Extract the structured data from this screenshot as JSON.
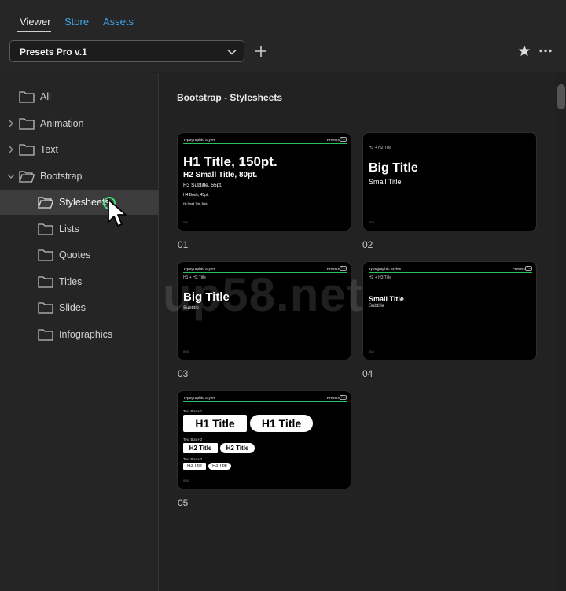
{
  "tabs": [
    {
      "label": "Viewer"
    },
    {
      "label": "Store"
    },
    {
      "label": "Assets"
    }
  ],
  "preset": {
    "selected": "Presets Pro v.1"
  },
  "icons": {
    "chevron": "chevron-down-icon",
    "add": "plus-icon",
    "favorite": "star-icon",
    "more": "more-horizontal-icon",
    "folder": "folder-icon"
  },
  "sidebar": {
    "items": [
      {
        "label": "All"
      },
      {
        "label": "Animation"
      },
      {
        "label": "Text"
      },
      {
        "label": "Bootstrap"
      },
      {
        "label": "Stylesheets"
      },
      {
        "label": "Lists"
      },
      {
        "label": "Quotes"
      },
      {
        "label": "Titles"
      },
      {
        "label": "Slides"
      },
      {
        "label": "Infographics"
      }
    ]
  },
  "section": {
    "title": "Bootstrap - Stylesheets"
  },
  "cards": [
    {
      "label": "01",
      "header_left": "Typographic Styles",
      "header_right": "Presets",
      "header_badge": "Pro",
      "line1": "H1 Title, 150pt.",
      "line2": "H2 Small Title, 80pt.",
      "line3": "H3 Subtitle, 55pt.",
      "line4": "H4 Body, 45pt.",
      "line5": "H5 Small Text, 30pt.",
      "footer": "001"
    },
    {
      "label": "02",
      "subhead": "H1 + H2 Title",
      "big": "Big Title",
      "small": "Small Title",
      "footer": "002"
    },
    {
      "label": "03",
      "header_left": "Typographic Styles",
      "header_right": "Presets",
      "header_badge": "Pro",
      "subhead": "H1 + H3 Title",
      "big": "Big Title",
      "small": "Subtitle",
      "footer": "003"
    },
    {
      "label": "04",
      "header_left": "Typographic Styles",
      "header_right": "Presets",
      "header_badge": "Pro",
      "subhead": "H2 + H3 Title",
      "big": "Small Title",
      "small": "Subtitle",
      "footer": "004"
    },
    {
      "label": "05",
      "header_left": "Typographic Styles",
      "header_right": "Presets",
      "header_badge": "Pro",
      "box1_label": "Text Box H1",
      "h1a": "H1 Title",
      "h1b": "H1 Title",
      "box2_label": "Text Box H2",
      "h2a": "H2 Title",
      "h2b": "H2 Title",
      "box3_label": "Text Box H3",
      "h3a": "H3 Title",
      "h3b": "H3 Title",
      "footer": "005"
    }
  ],
  "watermark": "up58.net",
  "colors": {
    "accent": "#3fa4e8",
    "cursor_ring": "#43e07c",
    "card_rule": "#29c25a"
  }
}
